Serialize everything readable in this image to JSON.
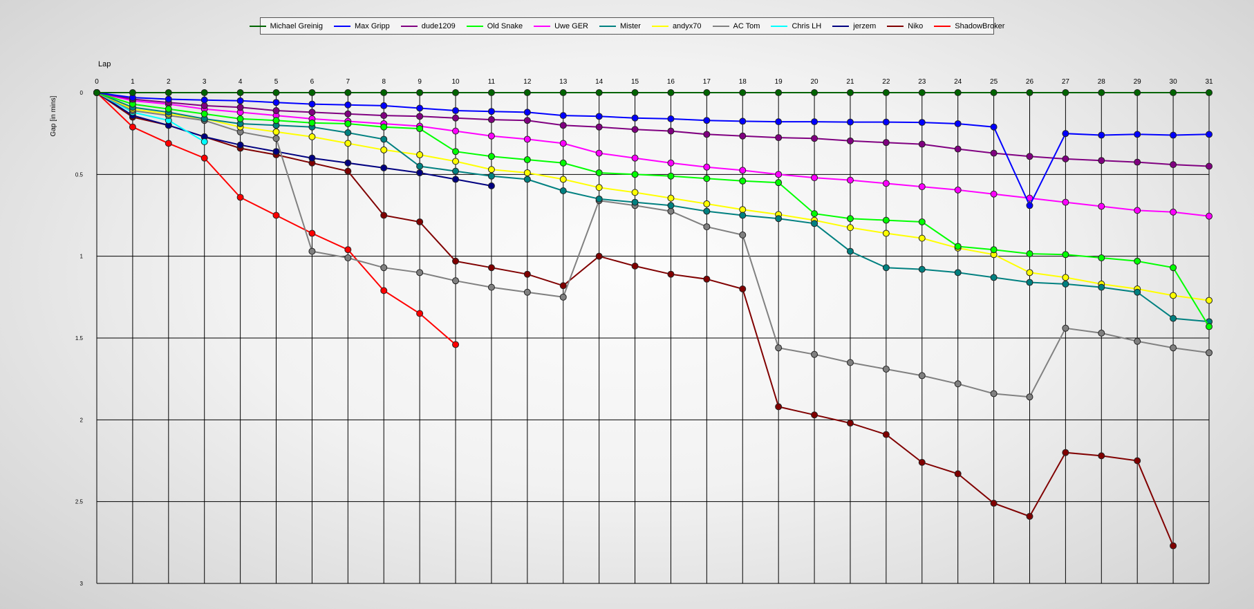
{
  "chart_data": {
    "type": "line",
    "title": "",
    "xlabel": "Lap",
    "ylabel": "Gap [in mins]",
    "x_ticks": [
      "0",
      "1",
      "2",
      "3",
      "4",
      "5",
      "6",
      "7",
      "8",
      "9",
      "10",
      "11",
      "12",
      "13",
      "14",
      "15",
      "16",
      "17",
      "18",
      "19",
      "20",
      "21",
      "22",
      "23",
      "24",
      "25",
      "26",
      "27",
      "28",
      "29",
      "30",
      "31"
    ],
    "y_ticks": [
      "0",
      "0.5",
      "1",
      "1.5",
      "2",
      "2.5",
      "3"
    ],
    "xlim": [
      0,
      31
    ],
    "ylim": [
      0,
      3
    ],
    "y_inverted": true,
    "grid": true,
    "legend_position": "top-center",
    "series": [
      {
        "name": "Michael Greinig",
        "color": "#006400",
        "values": [
          0,
          0,
          0,
          0,
          0,
          0,
          0,
          0,
          0,
          0,
          0,
          0,
          0,
          0,
          0,
          0,
          0,
          0,
          0,
          0,
          0,
          0,
          0,
          0,
          0,
          0,
          0,
          0,
          0,
          0,
          0,
          0
        ]
      },
      {
        "name": "Max Gripp",
        "color": "#0000ff",
        "values": [
          0,
          0.03,
          0.04,
          0.045,
          0.05,
          0.06,
          0.07,
          0.075,
          0.08,
          0.095,
          0.11,
          0.115,
          0.12,
          0.14,
          0.145,
          0.155,
          0.16,
          0.17,
          0.175,
          0.178,
          0.178,
          0.18,
          0.18,
          0.182,
          0.19,
          0.21,
          0.69,
          0.25,
          0.26,
          0.255,
          0.26,
          0.255
        ]
      },
      {
        "name": "dude1209",
        "color": "#800080",
        "values": [
          0,
          0.04,
          0.06,
          0.08,
          0.09,
          0.11,
          0.12,
          0.13,
          0.14,
          0.145,
          0.155,
          0.165,
          0.17,
          0.2,
          0.21,
          0.225,
          0.235,
          0.255,
          0.265,
          0.275,
          0.28,
          0.295,
          0.305,
          0.315,
          0.345,
          0.37,
          0.39,
          0.405,
          0.415,
          0.425,
          0.44,
          0.45
        ]
      },
      {
        "name": "Old Snake",
        "color": "#00ff00",
        "values": [
          0,
          0.07,
          0.1,
          0.13,
          0.16,
          0.17,
          0.185,
          0.19,
          0.21,
          0.22,
          0.36,
          0.39,
          0.41,
          0.43,
          0.49,
          0.5,
          0.51,
          0.525,
          0.54,
          0.55,
          0.74,
          0.77,
          0.78,
          0.79,
          0.94,
          0.96,
          0.985,
          0.99,
          1.01,
          1.03,
          1.07,
          1.43
        ]
      },
      {
        "name": "Uwe GER",
        "color": "#ff00ff",
        "values": [
          0,
          0.05,
          0.07,
          0.1,
          0.12,
          0.14,
          0.16,
          0.175,
          0.19,
          0.205,
          0.235,
          0.265,
          0.285,
          0.31,
          0.37,
          0.4,
          0.43,
          0.455,
          0.475,
          0.5,
          0.52,
          0.535,
          0.555,
          0.575,
          0.595,
          0.62,
          0.645,
          0.67,
          0.695,
          0.72,
          0.73,
          0.755
        ]
      },
      {
        "name": "Mister",
        "color": "#008080",
        "values": [
          0,
          0.09,
          0.12,
          0.16,
          0.19,
          0.2,
          0.21,
          0.245,
          0.285,
          0.45,
          0.48,
          0.51,
          0.53,
          0.6,
          0.65,
          0.67,
          0.69,
          0.725,
          0.75,
          0.77,
          0.8,
          0.97,
          1.07,
          1.08,
          1.1,
          1.13,
          1.16,
          1.17,
          1.19,
          1.22,
          1.38,
          1.4
        ]
      },
      {
        "name": "andyx70",
        "color": "#ffff00",
        "values": [
          0,
          0.1,
          0.13,
          0.16,
          0.21,
          0.24,
          0.27,
          0.31,
          0.35,
          0.38,
          0.42,
          0.47,
          0.49,
          0.53,
          0.58,
          0.61,
          0.645,
          0.68,
          0.715,
          0.745,
          0.78,
          0.825,
          0.86,
          0.89,
          0.95,
          0.99,
          1.1,
          1.13,
          1.17,
          1.2,
          1.24,
          1.27
        ]
      },
      {
        "name": "AC Tom",
        "color": "#808080",
        "values": [
          0,
          0.11,
          0.14,
          0.17,
          0.24,
          0.28,
          0.97,
          1.01,
          1.07,
          1.1,
          1.15,
          1.19,
          1.22,
          1.25,
          0.66,
          0.69,
          0.725,
          0.82,
          0.87,
          1.56,
          1.6,
          1.65,
          1.69,
          1.73,
          1.78,
          1.84,
          1.86,
          1.44,
          1.47,
          1.52,
          1.56,
          1.59
        ]
      },
      {
        "name": "Chris LH",
        "color": "#00ffff",
        "values": [
          0,
          0.12,
          0.17,
          0.3
        ]
      },
      {
        "name": "jerzem",
        "color": "#000080",
        "values": [
          0,
          0.14,
          0.2,
          0.27,
          0.32,
          0.36,
          0.4,
          0.43,
          0.46,
          0.49,
          0.53,
          0.57
        ]
      },
      {
        "name": "Niko",
        "color": "#800000",
        "values": [
          0,
          0.15,
          0.2,
          0.27,
          0.34,
          0.38,
          0.43,
          0.48,
          0.75,
          0.79,
          1.03,
          1.07,
          1.11,
          1.18,
          1.0,
          1.06,
          1.11,
          1.14,
          1.2,
          1.92,
          1.97,
          2.02,
          2.09,
          2.26,
          2.33,
          2.51,
          2.59,
          2.2,
          2.22,
          2.25,
          2.77
        ]
      },
      {
        "name": "ShadowBroker",
        "color": "#ff0000",
        "values": [
          0,
          0.21,
          0.31,
          0.4,
          0.64,
          0.75,
          0.86,
          0.96,
          1.21,
          1.35,
          1.54
        ]
      }
    ]
  }
}
